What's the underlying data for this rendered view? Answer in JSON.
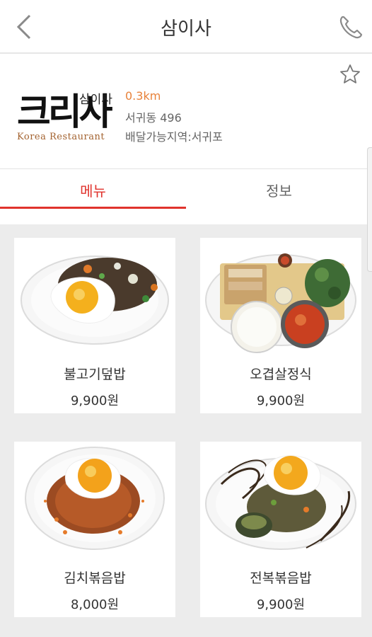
{
  "header": {
    "title": "삼이사",
    "back_icon": "chevron-left-icon",
    "call_icon": "phone-icon"
  },
  "restaurant": {
    "logo_main": "크리사",
    "logo_sub": "삼이사",
    "logo_english": "Korea Restaurant",
    "distance": "0.3km",
    "address": "서귀동 496",
    "delivery_area": "배달가능지역:서귀포",
    "favorite_icon": "star-outline-icon"
  },
  "tabs": [
    {
      "label": "메뉴",
      "active": true
    },
    {
      "label": "정보",
      "active": false
    }
  ],
  "menu": [
    {
      "name": "불고기덮밥",
      "price": "9,900원"
    },
    {
      "name": "오겹살정식",
      "price": "9,900원"
    },
    {
      "name": "김치볶음밥",
      "price": "8,000원"
    },
    {
      "name": "전복볶음밥",
      "price": "9,900원"
    }
  ],
  "colors": {
    "accent": "#e0332d",
    "distance": "#e8823a",
    "background": "#ececec"
  }
}
